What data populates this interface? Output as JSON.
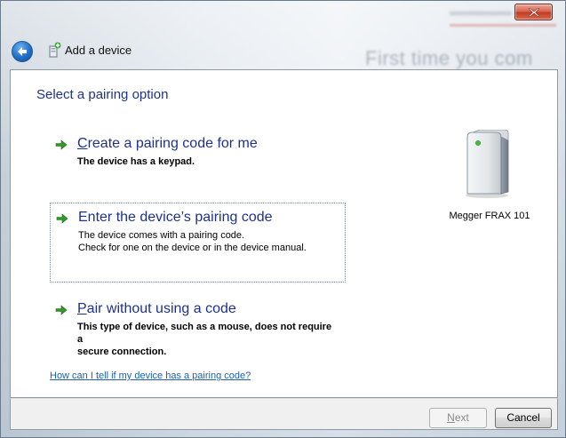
{
  "window": {
    "title": "Add a device",
    "background_text": "First time you com"
  },
  "page": {
    "heading": "Select a pairing option"
  },
  "options": [
    {
      "title_accel": "C",
      "title_rest": "reate a pairing code for me",
      "description": "The device has a keypad.",
      "selected": false
    },
    {
      "title_accel": "",
      "title_rest": "Enter the device’s pairing code",
      "description": "The device comes with a pairing code.\nCheck for one on the device or in the device manual.",
      "selected": true
    },
    {
      "title_accel": "P",
      "title_rest": "air without using a code",
      "description": "This type of device, such as a mouse, does not require a\nsecure connection.",
      "selected": false
    }
  ],
  "help_link": "How can I tell if my device has a pairing code?",
  "device": {
    "name": "Megger FRAX 101",
    "icon": "computer-tower-icon"
  },
  "buttons": {
    "next_accel": "N",
    "next_rest": "ext",
    "next_enabled": false,
    "cancel": "Cancel"
  },
  "colors": {
    "link_blue": "#1e3287",
    "arrow_green": "#2f9a2a",
    "close_red": "#c03b22"
  }
}
